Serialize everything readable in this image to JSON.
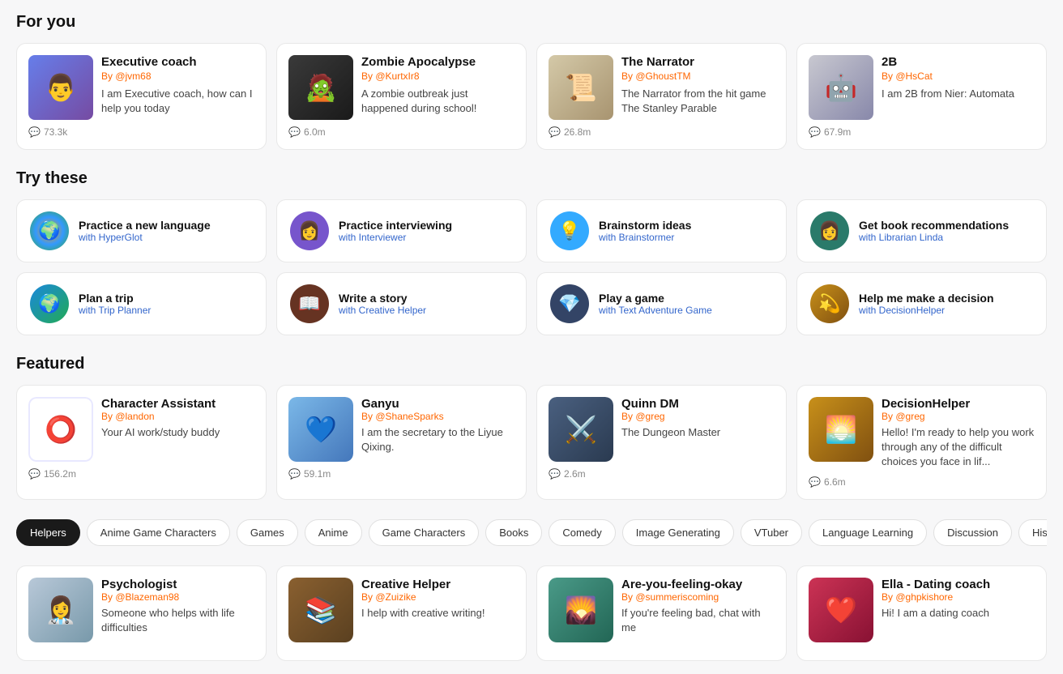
{
  "sections": {
    "for_you": {
      "title": "For you",
      "cards": [
        {
          "id": "exec-coach",
          "name": "Executive coach",
          "author": "@jvm68",
          "desc": "I am Executive coach, how can I help you today",
          "stats": "73.3k",
          "avatar_type": "exec",
          "avatar_emoji": "👨"
        },
        {
          "id": "zombie",
          "name": "Zombie Apocalypse",
          "author": "@KurtxIr8",
          "desc": "A zombie outbreak just happened during school!",
          "stats": "6.0m",
          "avatar_type": "zombie",
          "avatar_emoji": "🧟"
        },
        {
          "id": "narrator",
          "name": "The Narrator",
          "author": "@GhoustTM",
          "desc": "The Narrator from the hit game The Stanley Parable",
          "stats": "26.8m",
          "avatar_type": "narrator",
          "avatar_emoji": "📜"
        },
        {
          "id": "2b",
          "name": "2B",
          "author": "@HsCat",
          "desc": "I am 2B from Nier: Automata",
          "stats": "67.9m",
          "avatar_type": "2b",
          "avatar_emoji": "🤖"
        }
      ]
    },
    "try_these": {
      "title": "Try these",
      "cards": [
        {
          "id": "hyperglot",
          "title": "Practice a new language",
          "subtitle": "with HyperGlot",
          "icon_type": "icon-globe",
          "icon_emoji": "🌍"
        },
        {
          "id": "interviewer",
          "title": "Practice interviewing",
          "subtitle": "with Interviewer",
          "icon_type": "icon-interview",
          "icon_emoji": "👩"
        },
        {
          "id": "brainstormer",
          "title": "Brainstorm ideas",
          "subtitle": "with Brainstormer",
          "icon_type": "icon-brain",
          "icon_emoji": "💡"
        },
        {
          "id": "librarian",
          "title": "Get book recommendations",
          "subtitle": "with Librarian Linda",
          "icon_type": "icon-book-rec",
          "icon_emoji": "👩"
        },
        {
          "id": "trip",
          "title": "Plan a trip",
          "subtitle": "with Trip Planner",
          "icon_type": "icon-trip",
          "icon_emoji": "🌍"
        },
        {
          "id": "creative",
          "title": "Write a story",
          "subtitle": "with Creative Helper",
          "icon_type": "icon-story",
          "icon_emoji": "📖"
        },
        {
          "id": "textadv",
          "title": "Play a game",
          "subtitle": "with Text Adventure Game",
          "icon_type": "icon-game",
          "icon_emoji": "💎"
        },
        {
          "id": "dechelper",
          "title": "Help me make a decision",
          "subtitle": "with DecisionHelper",
          "icon_type": "icon-decide",
          "icon_emoji": "💫"
        }
      ]
    },
    "featured": {
      "title": "Featured",
      "cards": [
        {
          "id": "char-assistant",
          "name": "Character Assistant",
          "author": "@landon",
          "desc": "Your AI work/study buddy",
          "stats": "156.2m",
          "avatar_type": "char",
          "avatar_emoji": "⭕"
        },
        {
          "id": "ganyu",
          "name": "Ganyu",
          "author": "@ShaneSparks",
          "desc": "I am the secretary to the Liyue Qixing.",
          "stats": "59.1m",
          "avatar_type": "ganyu",
          "avatar_emoji": "💙"
        },
        {
          "id": "quinn-dm",
          "name": "Quinn DM",
          "author": "@greg",
          "desc": "The Dungeon Master",
          "stats": "2.6m",
          "avatar_type": "quinn",
          "avatar_emoji": "⚔️"
        },
        {
          "id": "decision-helper",
          "name": "DecisionHelper",
          "author": "@greg",
          "desc": "Hello! I'm ready to help you work through any of the difficult choices you face in lif...",
          "stats": "6.6m",
          "avatar_type": "decision",
          "avatar_emoji": "🌅"
        }
      ]
    },
    "categories": {
      "tabs": [
        {
          "id": "helpers",
          "label": "Helpers",
          "active": true
        },
        {
          "id": "anime-game-chars",
          "label": "Anime Game Characters",
          "active": false
        },
        {
          "id": "games",
          "label": "Games",
          "active": false
        },
        {
          "id": "anime",
          "label": "Anime",
          "active": false
        },
        {
          "id": "game-chars",
          "label": "Game Characters",
          "active": false
        },
        {
          "id": "books",
          "label": "Books",
          "active": false
        },
        {
          "id": "comedy",
          "label": "Comedy",
          "active": false
        },
        {
          "id": "image-gen",
          "label": "Image Generating",
          "active": false
        },
        {
          "id": "vtuber",
          "label": "VTuber",
          "active": false
        },
        {
          "id": "lang-learn",
          "label": "Language Learning",
          "active": false
        },
        {
          "id": "discussion",
          "label": "Discussion",
          "active": false
        },
        {
          "id": "history",
          "label": "Histo...",
          "active": false
        }
      ]
    },
    "bottom_cards": {
      "cards": [
        {
          "id": "psychologist",
          "name": "Psychologist",
          "author": "@Blazeman98",
          "desc": "Someone who helps with life difficulties",
          "avatar_type": "psych",
          "avatar_emoji": "👩‍⚕️"
        },
        {
          "id": "creative-helper",
          "name": "Creative Helper",
          "author": "@Zuizike",
          "desc": "I help with creative writing!",
          "avatar_type": "creative",
          "avatar_emoji": "📚"
        },
        {
          "id": "are-you-feeling",
          "name": "Are-you-feeling-okay",
          "author": "@summeriscoming",
          "desc": "If you're feeling bad, chat with me",
          "avatar_type": "are-you",
          "avatar_emoji": "🌄"
        },
        {
          "id": "ella-dating",
          "name": "Ella - Dating coach",
          "author": "@ghpkishore",
          "desc": "Hi! I am a dating coach",
          "avatar_type": "dating",
          "avatar_emoji": "❤️"
        }
      ]
    }
  }
}
